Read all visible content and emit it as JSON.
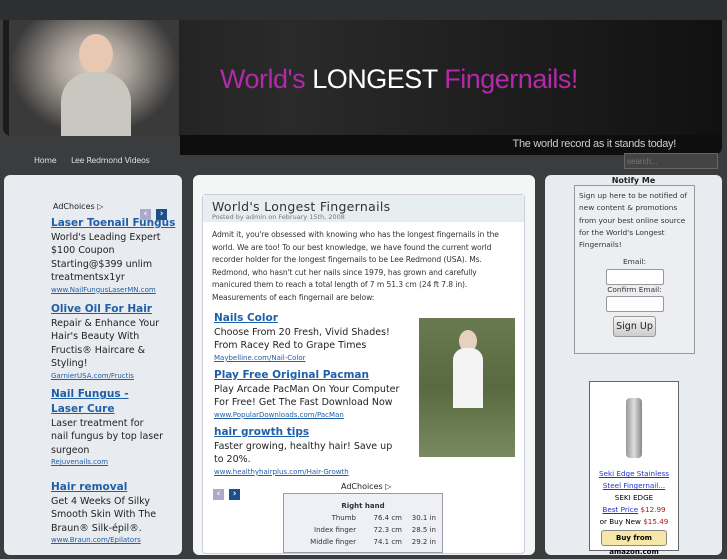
{
  "header": {
    "title_pre": "World's",
    "title_mid": "LONGEST",
    "title_post": "Fingernails!",
    "tagline": "The world record as it stands today!"
  },
  "nav": {
    "items": [
      "Home",
      "Lee Redmond Videos"
    ],
    "search_placeholder": "search..."
  },
  "left_ads": {
    "adchoices": "AdChoices",
    "items": [
      {
        "title": "Laser Toenail Fungus",
        "text": "World's Leading Expert $100 Coupon Starting@$399 unlim treatmentsx1yr",
        "url": "www.NailFungusLaserMN.com"
      },
      {
        "title": "Olive Oil For Hair",
        "text": "Repair & Enhance Your Hair's Beauty With Fructis® Haircare & Styling!",
        "url": "GarnierUSA.com/Fructis"
      },
      {
        "title": "Nail Fungus - Laser Cure",
        "text": "Laser treatment for nail fungus by top laser surgeon",
        "url": "Rejuvenails.com"
      },
      {
        "title": "Hair removal",
        "text": "Get 4 Weeks Of Silky Smooth Skin With The Braun® Silk-épil®.",
        "url": "www.Braun.com/Epilators"
      }
    ]
  },
  "post": {
    "title": "World's Longest Fingernails",
    "meta": "Posted by admin on February 15th, 2008",
    "body": "Admit it, you're obsessed with knowing who has the longest fingernails in the world. We are too! To our best knowledge, we have found the current world recorder holder for the longest fingernails to be Lee Redmond (USA). Ms. Redmond, who hasn't cut her nails since 1979, has grown and carefully manicured them to reach a total length of 7 m 51.3 cm (24 ft 7.8 in). Measurements of each fingernail are below:",
    "ads": [
      {
        "title": "Nails Color",
        "text": "Choose From 20 Fresh, Vivid Shades! From Racey Red to Grape Times",
        "url": "Maybelline.com/Nail-Color"
      },
      {
        "title": "Play Free Original Pacman",
        "text": "Play Arcade PacMan On Your Computer For Free! Get The Fast Download Now",
        "url": "www.PopularDownloads.com/PacMan"
      },
      {
        "title": "hair growth tips",
        "text": "Faster growing, healthy hair! Save up to 20%.",
        "url": "www.healthyhairplus.com/Hair-Growth"
      }
    ],
    "adchoices": "AdChoices",
    "table": {
      "heading": "Right hand",
      "rows": [
        [
          "Thumb",
          "76.4 cm",
          "30.1 in"
        ],
        [
          "Index finger",
          "72.3 cm",
          "28.5 in"
        ],
        [
          "Middle finger",
          "74.1 cm",
          "29.2 in"
        ]
      ]
    }
  },
  "notify": {
    "title": "Notify Me",
    "text": "Sign up here to be notified of new content & promotions from your best online source for the World's Longest Fingernails!",
    "email_label": "Email:",
    "confirm_label": "Confirm Email:",
    "button": "Sign Up"
  },
  "amazon": {
    "product": "Seki Edge Stainless Steel Fingernail...",
    "brand": "SEKI EDGE",
    "best_label": "Best Price",
    "best_price": "$12.99",
    "new_label": "or Buy New",
    "new_price": "$15.49",
    "buy": "Buy from amazon.com"
  }
}
